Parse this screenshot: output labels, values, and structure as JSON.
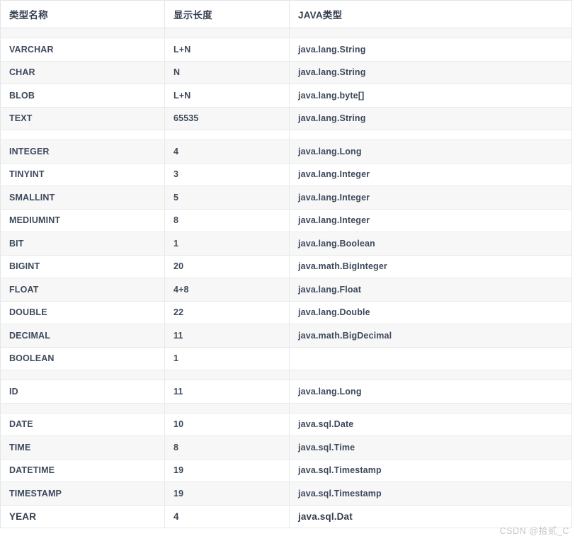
{
  "table": {
    "headers": [
      "类型名称",
      "显示长度",
      "JAVA类型"
    ],
    "rows": [
      {
        "kind": "spacer",
        "stripe": "grey",
        "type_name": "",
        "display_length": "",
        "java_type": ""
      },
      {
        "kind": "data",
        "stripe": "white",
        "type_name": "VARCHAR",
        "display_length": "L+N",
        "java_type": "java.lang.String"
      },
      {
        "kind": "data",
        "stripe": "grey",
        "type_name": "CHAR",
        "display_length": "N",
        "java_type": "java.lang.String"
      },
      {
        "kind": "data",
        "stripe": "white",
        "type_name": "BLOB",
        "display_length": "L+N",
        "java_type": "java.lang.byte[]"
      },
      {
        "kind": "data",
        "stripe": "grey",
        "type_name": "TEXT",
        "display_length": "65535",
        "java_type": "java.lang.String"
      },
      {
        "kind": "spacer",
        "stripe": "white",
        "type_name": "",
        "display_length": "",
        "java_type": ""
      },
      {
        "kind": "data",
        "stripe": "grey",
        "type_name": "INTEGER",
        "display_length": "4",
        "java_type": "java.lang.Long"
      },
      {
        "kind": "data",
        "stripe": "white",
        "type_name": "TINYINT",
        "display_length": "3",
        "java_type": "java.lang.Integer"
      },
      {
        "kind": "data",
        "stripe": "grey",
        "type_name": "SMALLINT",
        "display_length": "5",
        "java_type": "java.lang.Integer"
      },
      {
        "kind": "data",
        "stripe": "white",
        "type_name": "MEDIUMINT",
        "display_length": "8",
        "java_type": "java.lang.Integer"
      },
      {
        "kind": "data",
        "stripe": "grey",
        "type_name": "BIT",
        "display_length": "1",
        "java_type": "java.lang.Boolean"
      },
      {
        "kind": "data",
        "stripe": "white",
        "type_name": "BIGINT",
        "display_length": "20",
        "java_type": "java.math.BigInteger"
      },
      {
        "kind": "data",
        "stripe": "grey",
        "type_name": "FLOAT",
        "display_length": "4+8",
        "java_type": "java.lang.Float"
      },
      {
        "kind": "data",
        "stripe": "white",
        "type_name": "DOUBLE",
        "display_length": "22",
        "java_type": "java.lang.Double"
      },
      {
        "kind": "data",
        "stripe": "grey",
        "type_name": "DECIMAL",
        "display_length": "11",
        "java_type": "java.math.BigDecimal"
      },
      {
        "kind": "data",
        "stripe": "white",
        "type_name": "BOOLEAN",
        "display_length": "1",
        "java_type": ""
      },
      {
        "kind": "spacer",
        "stripe": "grey",
        "type_name": "",
        "display_length": "",
        "java_type": ""
      },
      {
        "kind": "data",
        "stripe": "white",
        "type_name": "ID",
        "display_length": "11",
        "java_type": "java.lang.Long"
      },
      {
        "kind": "spacer",
        "stripe": "grey",
        "type_name": "",
        "display_length": "",
        "java_type": ""
      },
      {
        "kind": "data",
        "stripe": "white",
        "type_name": "DATE",
        "display_length": "10",
        "java_type": "java.sql.Date"
      },
      {
        "kind": "data",
        "stripe": "grey",
        "type_name": "TIME",
        "display_length": "8",
        "java_type": "java.sql.Time"
      },
      {
        "kind": "data",
        "stripe": "white",
        "type_name": "DATETIME",
        "display_length": "19",
        "java_type": "java.sql.Timestamp"
      },
      {
        "kind": "data",
        "stripe": "grey",
        "type_name": "TIMESTAMP",
        "display_length": "19",
        "java_type": "java.sql.Timestamp"
      },
      {
        "kind": "data",
        "stripe": "white",
        "emphasis": true,
        "type_name": "YEAR",
        "display_length": "4",
        "java_type": "java.sql.Dat"
      }
    ]
  },
  "watermark": {
    "text": "CSDN @拾贰_C"
  },
  "colors": {
    "border": "#e3e5e8",
    "row_stripe": "#f7f7f8",
    "row_base": "#ffffff",
    "text": "#3d4a5c",
    "header_text": "#34404e",
    "watermark_text": "#c3c6ca"
  }
}
